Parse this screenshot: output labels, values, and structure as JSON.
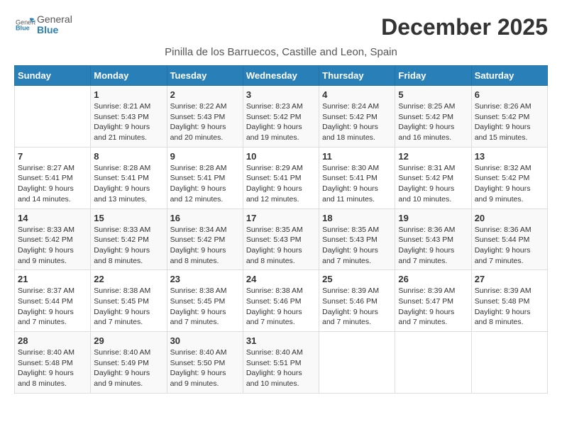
{
  "logo": {
    "general": "General",
    "blue": "Blue"
  },
  "title": "December 2025",
  "subtitle": "Pinilla de los Barruecos, Castille and Leon, Spain",
  "headers": [
    "Sunday",
    "Monday",
    "Tuesday",
    "Wednesday",
    "Thursday",
    "Friday",
    "Saturday"
  ],
  "weeks": [
    [
      {
        "day": "",
        "sunrise": "",
        "sunset": "",
        "daylight": ""
      },
      {
        "day": "1",
        "sunrise": "Sunrise: 8:21 AM",
        "sunset": "Sunset: 5:43 PM",
        "daylight": "Daylight: 9 hours and 21 minutes."
      },
      {
        "day": "2",
        "sunrise": "Sunrise: 8:22 AM",
        "sunset": "Sunset: 5:43 PM",
        "daylight": "Daylight: 9 hours and 20 minutes."
      },
      {
        "day": "3",
        "sunrise": "Sunrise: 8:23 AM",
        "sunset": "Sunset: 5:42 PM",
        "daylight": "Daylight: 9 hours and 19 minutes."
      },
      {
        "day": "4",
        "sunrise": "Sunrise: 8:24 AM",
        "sunset": "Sunset: 5:42 PM",
        "daylight": "Daylight: 9 hours and 18 minutes."
      },
      {
        "day": "5",
        "sunrise": "Sunrise: 8:25 AM",
        "sunset": "Sunset: 5:42 PM",
        "daylight": "Daylight: 9 hours and 16 minutes."
      },
      {
        "day": "6",
        "sunrise": "Sunrise: 8:26 AM",
        "sunset": "Sunset: 5:42 PM",
        "daylight": "Daylight: 9 hours and 15 minutes."
      }
    ],
    [
      {
        "day": "7",
        "sunrise": "Sunrise: 8:27 AM",
        "sunset": "Sunset: 5:41 PM",
        "daylight": "Daylight: 9 hours and 14 minutes."
      },
      {
        "day": "8",
        "sunrise": "Sunrise: 8:28 AM",
        "sunset": "Sunset: 5:41 PM",
        "daylight": "Daylight: 9 hours and 13 minutes."
      },
      {
        "day": "9",
        "sunrise": "Sunrise: 8:28 AM",
        "sunset": "Sunset: 5:41 PM",
        "daylight": "Daylight: 9 hours and 12 minutes."
      },
      {
        "day": "10",
        "sunrise": "Sunrise: 8:29 AM",
        "sunset": "Sunset: 5:41 PM",
        "daylight": "Daylight: 9 hours and 12 minutes."
      },
      {
        "day": "11",
        "sunrise": "Sunrise: 8:30 AM",
        "sunset": "Sunset: 5:41 PM",
        "daylight": "Daylight: 9 hours and 11 minutes."
      },
      {
        "day": "12",
        "sunrise": "Sunrise: 8:31 AM",
        "sunset": "Sunset: 5:42 PM",
        "daylight": "Daylight: 9 hours and 10 minutes."
      },
      {
        "day": "13",
        "sunrise": "Sunrise: 8:32 AM",
        "sunset": "Sunset: 5:42 PM",
        "daylight": "Daylight: 9 hours and 9 minutes."
      }
    ],
    [
      {
        "day": "14",
        "sunrise": "Sunrise: 8:33 AM",
        "sunset": "Sunset: 5:42 PM",
        "daylight": "Daylight: 9 hours and 9 minutes."
      },
      {
        "day": "15",
        "sunrise": "Sunrise: 8:33 AM",
        "sunset": "Sunset: 5:42 PM",
        "daylight": "Daylight: 9 hours and 8 minutes."
      },
      {
        "day": "16",
        "sunrise": "Sunrise: 8:34 AM",
        "sunset": "Sunset: 5:42 PM",
        "daylight": "Daylight: 9 hours and 8 minutes."
      },
      {
        "day": "17",
        "sunrise": "Sunrise: 8:35 AM",
        "sunset": "Sunset: 5:43 PM",
        "daylight": "Daylight: 9 hours and 8 minutes."
      },
      {
        "day": "18",
        "sunrise": "Sunrise: 8:35 AM",
        "sunset": "Sunset: 5:43 PM",
        "daylight": "Daylight: 9 hours and 7 minutes."
      },
      {
        "day": "19",
        "sunrise": "Sunrise: 8:36 AM",
        "sunset": "Sunset: 5:43 PM",
        "daylight": "Daylight: 9 hours and 7 minutes."
      },
      {
        "day": "20",
        "sunrise": "Sunrise: 8:36 AM",
        "sunset": "Sunset: 5:44 PM",
        "daylight": "Daylight: 9 hours and 7 minutes."
      }
    ],
    [
      {
        "day": "21",
        "sunrise": "Sunrise: 8:37 AM",
        "sunset": "Sunset: 5:44 PM",
        "daylight": "Daylight: 9 hours and 7 minutes."
      },
      {
        "day": "22",
        "sunrise": "Sunrise: 8:38 AM",
        "sunset": "Sunset: 5:45 PM",
        "daylight": "Daylight: 9 hours and 7 minutes."
      },
      {
        "day": "23",
        "sunrise": "Sunrise: 8:38 AM",
        "sunset": "Sunset: 5:45 PM",
        "daylight": "Daylight: 9 hours and 7 minutes."
      },
      {
        "day": "24",
        "sunrise": "Sunrise: 8:38 AM",
        "sunset": "Sunset: 5:46 PM",
        "daylight": "Daylight: 9 hours and 7 minutes."
      },
      {
        "day": "25",
        "sunrise": "Sunrise: 8:39 AM",
        "sunset": "Sunset: 5:46 PM",
        "daylight": "Daylight: 9 hours and 7 minutes."
      },
      {
        "day": "26",
        "sunrise": "Sunrise: 8:39 AM",
        "sunset": "Sunset: 5:47 PM",
        "daylight": "Daylight: 9 hours and 7 minutes."
      },
      {
        "day": "27",
        "sunrise": "Sunrise: 8:39 AM",
        "sunset": "Sunset: 5:48 PM",
        "daylight": "Daylight: 9 hours and 8 minutes."
      }
    ],
    [
      {
        "day": "28",
        "sunrise": "Sunrise: 8:40 AM",
        "sunset": "Sunset: 5:48 PM",
        "daylight": "Daylight: 9 hours and 8 minutes."
      },
      {
        "day": "29",
        "sunrise": "Sunrise: 8:40 AM",
        "sunset": "Sunset: 5:49 PM",
        "daylight": "Daylight: 9 hours and 9 minutes."
      },
      {
        "day": "30",
        "sunrise": "Sunrise: 8:40 AM",
        "sunset": "Sunset: 5:50 PM",
        "daylight": "Daylight: 9 hours and 9 minutes."
      },
      {
        "day": "31",
        "sunrise": "Sunrise: 8:40 AM",
        "sunset": "Sunset: 5:51 PM",
        "daylight": "Daylight: 9 hours and 10 minutes."
      },
      {
        "day": "",
        "sunrise": "",
        "sunset": "",
        "daylight": ""
      },
      {
        "day": "",
        "sunrise": "",
        "sunset": "",
        "daylight": ""
      },
      {
        "day": "",
        "sunrise": "",
        "sunset": "",
        "daylight": ""
      }
    ]
  ]
}
